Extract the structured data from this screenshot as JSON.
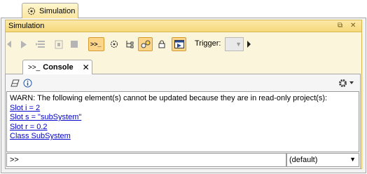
{
  "window_tab": {
    "label": "Simulation",
    "icon": "simulation-icon"
  },
  "panel": {
    "title": "Simulation",
    "controls": {
      "restore": "⧉",
      "close": "✕"
    }
  },
  "toolbar": {
    "buttons": [
      {
        "name": "step-back-icon",
        "state": "disabled"
      },
      {
        "name": "play-icon",
        "state": "disabled"
      },
      {
        "name": "step-into-icon",
        "state": "disabled"
      },
      {
        "name": "step-over-icon",
        "state": "disabled"
      },
      {
        "name": "stop-icon",
        "state": "disabled"
      },
      {
        "name": "console-toggle-icon",
        "state": "active"
      },
      {
        "name": "sessions-icon",
        "state": "normal"
      },
      {
        "name": "tree-icon",
        "state": "normal"
      },
      {
        "name": "animation-icon",
        "state": "active"
      },
      {
        "name": "lock-icon",
        "state": "normal"
      },
      {
        "name": "autostart-icon",
        "state": "active"
      }
    ],
    "trigger_label": "Trigger:"
  },
  "console_tab": {
    "label": "Console",
    "close": "✕",
    "prompt_icon": ">>_"
  },
  "console": {
    "messages": [
      {
        "type": "text",
        "text": "WARN: The following element(s) cannot be updated because they are in read-only project(s):"
      },
      {
        "type": "link",
        "text": "Slot i = 2"
      },
      {
        "type": "link",
        "text": "Slot s = \"subSystem\""
      },
      {
        "type": "link",
        "text": "Slot r = 0.2"
      },
      {
        "type": "link",
        "text": "Class SubSystem"
      }
    ],
    "input_value": ">>",
    "language_select": "(default)"
  }
}
